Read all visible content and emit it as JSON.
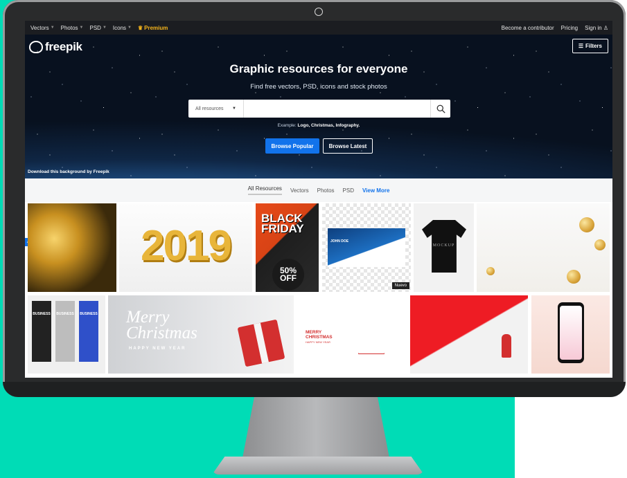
{
  "nav": {
    "items": [
      {
        "label": "Vectors"
      },
      {
        "label": "Photos"
      },
      {
        "label": "PSD"
      },
      {
        "label": "Icons"
      }
    ],
    "premium": "Premium",
    "right": {
      "contributor": "Become a contributor",
      "pricing": "Pricing",
      "signin": "Sign in"
    }
  },
  "hero": {
    "logo": "freepik",
    "filters": "Filters",
    "title": "Graphic resources for everyone",
    "subtitle": "Find free vectors, PSD, icons and stock photos",
    "search": {
      "select": "All resources",
      "placeholder": "",
      "value": ""
    },
    "example_label": "Example:",
    "example_terms": "Logo, Christmas, Infography.",
    "browse_popular": "Browse Popular",
    "browse_latest": "Browse Latest",
    "credit": "Download this background by Freepik"
  },
  "tabs": {
    "all": "All Resources",
    "vectors": "Vectors",
    "photos": "Photos",
    "psd": "PSD",
    "more": "View More"
  },
  "grid": {
    "t2_text": "2019",
    "t3_line1": "BLACK",
    "t3_line2": "FRIDAY",
    "t3_off1": "50%",
    "t3_off2": "OFF",
    "t4_name": "JOHN DOE",
    "t4_badge": "Nuevo",
    "t5_text": "MOCKUP",
    "t7_banner": "BUSINESS",
    "t8_line1": "Merry",
    "t8_line2": "Christmas",
    "t8_line3": "HAPPY NEW YEAR",
    "t9_line1": "MERRY",
    "t9_line2": "CHRISTMAS",
    "t9_line3": "HAPPY NEW YEAR"
  },
  "colors": {
    "teal": "#00dcb6",
    "accent": "#1273eb",
    "premium": "#f5b41b"
  }
}
